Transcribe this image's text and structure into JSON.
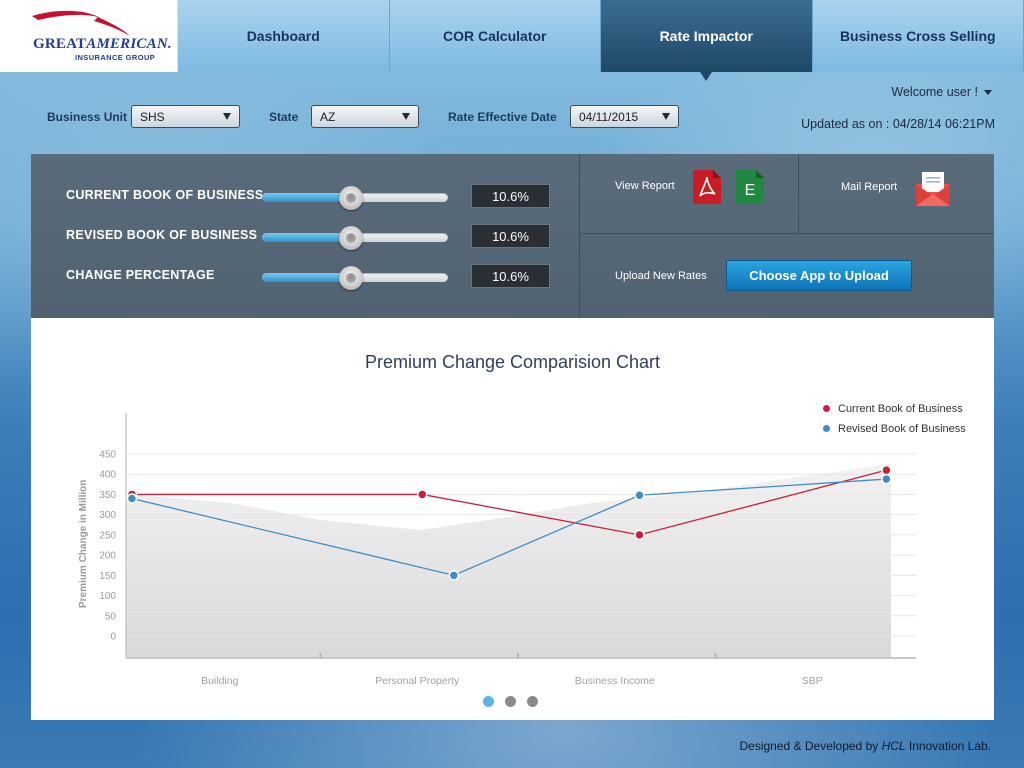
{
  "brand": {
    "line1_a": "GREAT",
    "line1_b": "AMERICAN.",
    "line2": "INSURANCE GROUP",
    "color": "#1f3e8c",
    "swoosh_color": "#c8102e"
  },
  "nav": {
    "tabs": [
      {
        "label": "Dashboard",
        "active": false
      },
      {
        "label": "COR Calculator",
        "active": false
      },
      {
        "label": "Rate Impactor",
        "active": true
      },
      {
        "label": "Business Cross Selling",
        "active": false
      }
    ]
  },
  "filters": {
    "business_unit_label": "Business Unit",
    "business_unit_value": "SHS",
    "state_label": "State",
    "state_value": "AZ",
    "rate_date_label": "Rate Effective Date",
    "rate_date_value": "04/11/2015"
  },
  "user": {
    "welcome": "Welcome user !",
    "updated": "Updated as on : 04/28/14  06:21PM"
  },
  "sliders": [
    {
      "label": "CURRENT BOOK OF BUSINESS",
      "value": "10.6%",
      "level": 0.48
    },
    {
      "label": "REVISED BOOK OF BUSINESS",
      "value": "10.6%",
      "level": 0.48
    },
    {
      "label": "CHANGE PERCENTAGE",
      "value": "10.6%",
      "level": 0.48
    }
  ],
  "reports": {
    "view_label": "View Report",
    "mail_label": "Mail Report",
    "upload_label": "Upload New Rates",
    "upload_button": "Choose App to Upload",
    "pdf_icon": "pdf-icon",
    "excel_icon": "excel-icon",
    "excel_letter": "E",
    "mail_icon": "envelope-icon"
  },
  "chart_data": {
    "type": "line",
    "title": "Premium Change Comparision Chart",
    "ylabel": "Premium Change in Million",
    "categories": [
      "Building",
      "Personal Property",
      "Business Income",
      "SBP"
    ],
    "yticks": [
      0,
      50,
      100,
      150,
      200,
      250,
      300,
      350,
      400,
      450
    ],
    "ylim": [
      0,
      450
    ],
    "series": [
      {
        "name": "Current Book of Business",
        "color": "#c8203a",
        "x": [
          0,
          1,
          2,
          3
        ],
        "values": [
          350,
          350,
          250,
          410
        ],
        "point_offsets": [
          -0.47,
          0,
          0.1,
          0.35
        ]
      },
      {
        "name": "Revised Book of Business",
        "color": "#3f8dc7",
        "x": [
          0,
          1,
          2,
          3
        ],
        "values": [
          340,
          150,
          348,
          388
        ],
        "point_offsets": [
          -0.47,
          0.16,
          0.1,
          0.35
        ]
      }
    ],
    "pager": {
      "count": 3,
      "active": 0
    }
  },
  "footer": {
    "text": "Designed & Developed by ",
    "company": "HCL",
    "suffix": " Innovation Lab."
  }
}
